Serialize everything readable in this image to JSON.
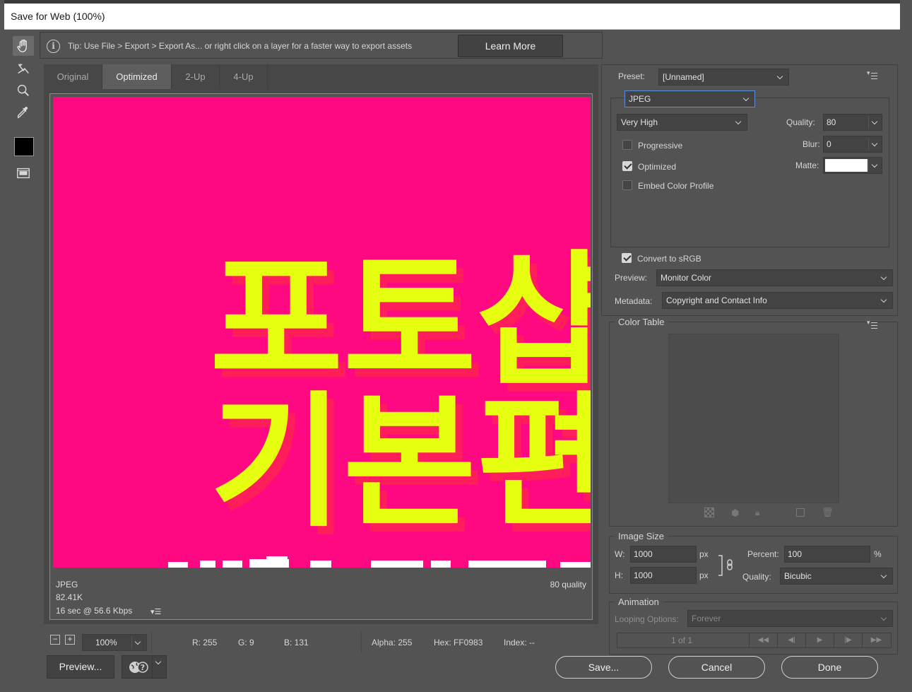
{
  "window": {
    "title": "Save for Web (100%)"
  },
  "tip": {
    "text": "Tip: Use File > Export > Export As...  or right click on a layer for a faster way to export assets",
    "learn_more_label": "Learn More"
  },
  "tabs": [
    {
      "label": "Original",
      "active": false
    },
    {
      "label": "Optimized",
      "active": true
    },
    {
      "label": "2-Up",
      "active": false
    },
    {
      "label": "4-Up",
      "active": false
    }
  ],
  "image": {
    "background_color": "#ff0983",
    "text_color": "#e6ff10",
    "shadow_color": "#ff1060",
    "line1": "포토샵",
    "line2": "기본편"
  },
  "image_info": {
    "format": "JPEG",
    "size": "82.41K",
    "download_time": "16 sec @ 56.6 Kbps",
    "quality_note": "80 quality"
  },
  "status": {
    "zoom": "100%",
    "r": "R: 255",
    "g": "G: 9",
    "b": "B: 131",
    "alpha": "Alpha: 255",
    "hex": "Hex: FF0983",
    "index": "Index: --"
  },
  "buttons": {
    "preview": "Preview...",
    "save": "Save...",
    "cancel": "Cancel",
    "done": "Done"
  },
  "settings": {
    "preset_label": "Preset:",
    "preset_value": "[Unnamed]",
    "format_value": "JPEG",
    "quality_level": "Very High",
    "quality_label": "Quality:",
    "quality_value": "80",
    "blur_label": "Blur:",
    "blur_value": "0",
    "matte_label": "Matte:",
    "matte_color": "#ffffff",
    "progressive_label": "Progressive",
    "progressive_checked": false,
    "optimized_label": "Optimized",
    "optimized_checked": true,
    "embed_profile_label": "Embed Color Profile",
    "embed_profile_checked": false,
    "convert_srgb_label": "Convert to sRGB",
    "convert_srgb_checked": true,
    "preview_label": "Preview:",
    "preview_value": "Monitor Color",
    "metadata_label": "Metadata:",
    "metadata_value": "Copyright and Contact Info"
  },
  "color_table": {
    "title": "Color Table"
  },
  "image_size": {
    "title": "Image Size",
    "w_label": "W:",
    "w_value": "1000",
    "h_label": "H:",
    "h_value": "1000",
    "unit": "px",
    "percent_label": "Percent:",
    "percent_value": "100",
    "percent_unit": "%",
    "quality_label": "Quality:",
    "quality_value": "Bicubic"
  },
  "animation": {
    "title": "Animation",
    "looping_label": "Looping Options:",
    "looping_value": "Forever",
    "frame_counter": "1 of 1"
  }
}
